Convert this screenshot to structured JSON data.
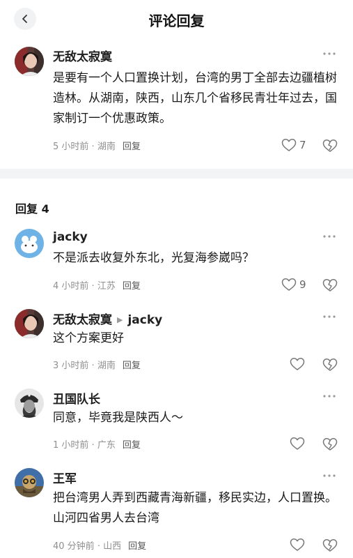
{
  "header": {
    "title": "评论回复"
  },
  "main_comment": {
    "name": "无敌太寂寞",
    "text": "是要有一个人口置换计划，台湾的男丁全部去边疆植树造林。从湖南，陕西，山东几个省移民青壮年过去，国家制订一个优惠政策。",
    "time": "5 小时前",
    "location": "湖南",
    "reply_label": "回复",
    "likes": "7"
  },
  "replies_header": {
    "label": "回复 4"
  },
  "replies": [
    {
      "name": "jacky",
      "reply_to": "",
      "text": "不是派去收复外东北，光复海参崴吗？",
      "time": "4 小时前",
      "location": "江苏",
      "reply_label": "回复",
      "likes": "9"
    },
    {
      "name": "无敌太寂寞",
      "reply_to": "jacky",
      "text": "这个方案更好",
      "time": "3 小时前",
      "location": "湖南",
      "reply_label": "回复",
      "likes": ""
    },
    {
      "name": "丑国队长",
      "reply_to": "",
      "text": "同意，毕竟我是陕西人～",
      "time": "1 小时前",
      "location": "广东",
      "reply_label": "回复",
      "likes": ""
    },
    {
      "name": "王军",
      "reply_to": "",
      "text": "把台湾男人弄到西藏青海新疆，移民实边，人口置换。山河四省男人去台湾",
      "time": "40 分钟前",
      "location": "山西",
      "reply_label": "回复",
      "likes": ""
    }
  ],
  "meta_separator": " · ",
  "icons": {
    "back": "chevron-left-icon",
    "more": "more-dots-icon",
    "like": "heart-icon",
    "dislike": "broken-heart-icon"
  }
}
